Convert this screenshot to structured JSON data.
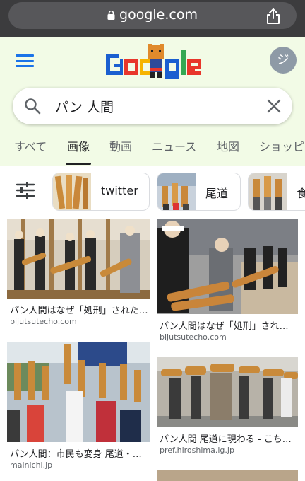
{
  "browser": {
    "url": "google.com"
  },
  "header": {
    "avatar_initial": "ジ"
  },
  "search": {
    "query": "パン 人間"
  },
  "tabs": [
    {
      "label": "すべて"
    },
    {
      "label": "画像"
    },
    {
      "label": "動画"
    },
    {
      "label": "ニュース"
    },
    {
      "label": "地図"
    },
    {
      "label": "ショッピ"
    }
  ],
  "active_tab": "画像",
  "chips": [
    {
      "label": "twitter"
    },
    {
      "label": "尾道"
    },
    {
      "label": "食"
    }
  ],
  "results": [
    {
      "title": "パン人間はなぜ「処刑」された…",
      "source": "bijutsutecho.com"
    },
    {
      "title": "パン人間はなぜ「処刑」され…",
      "source": "bijutsutecho.com"
    },
    {
      "title": "パン人間：市民も変身 尾道・…",
      "source": "mainichi.jp"
    },
    {
      "title": "パン人間 尾道に現わる - こち…",
      "source": "pref.hiroshima.lg.jp"
    }
  ],
  "colors": {
    "accent": "#1a73e8",
    "header_bg": "#f2fbe6",
    "browser_bar": "#3c3c3e"
  }
}
